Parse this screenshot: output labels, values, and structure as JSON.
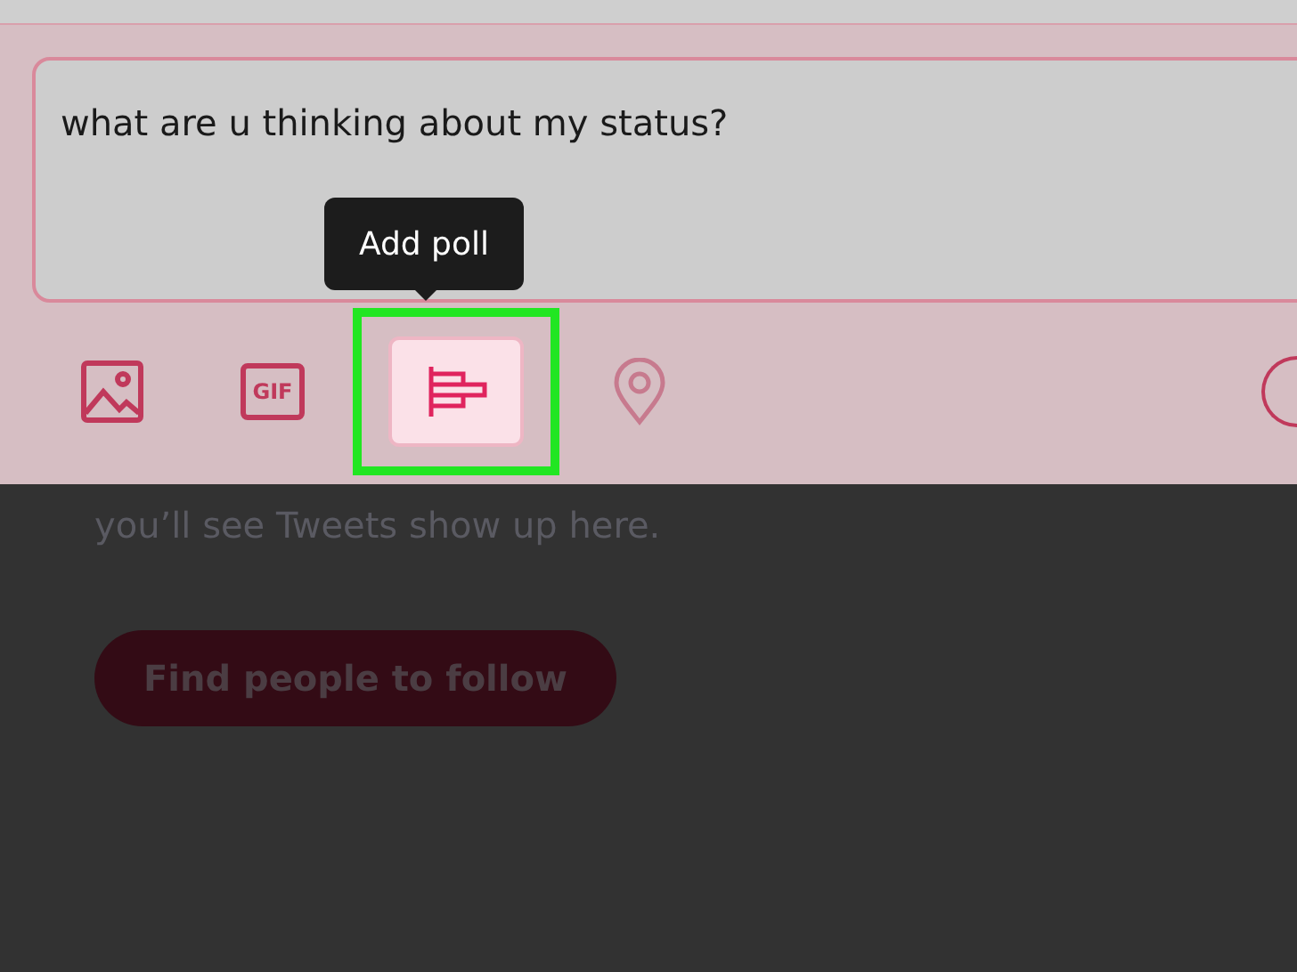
{
  "composer": {
    "value": "what are u thinking about my status?"
  },
  "tooltip": {
    "text": "Add poll"
  },
  "toolbar": [
    {
      "kind": "image",
      "selected": false,
      "highlighted": false
    },
    {
      "kind": "gif",
      "label": "GIF",
      "selected": false,
      "highlighted": false
    },
    {
      "kind": "poll",
      "selected": true,
      "highlighted": true
    },
    {
      "kind": "location",
      "selected": false,
      "highlighted": false
    }
  ],
  "empty_state": {
    "text": "you’ll see Tweets show up here.",
    "button": "Find people to follow"
  }
}
